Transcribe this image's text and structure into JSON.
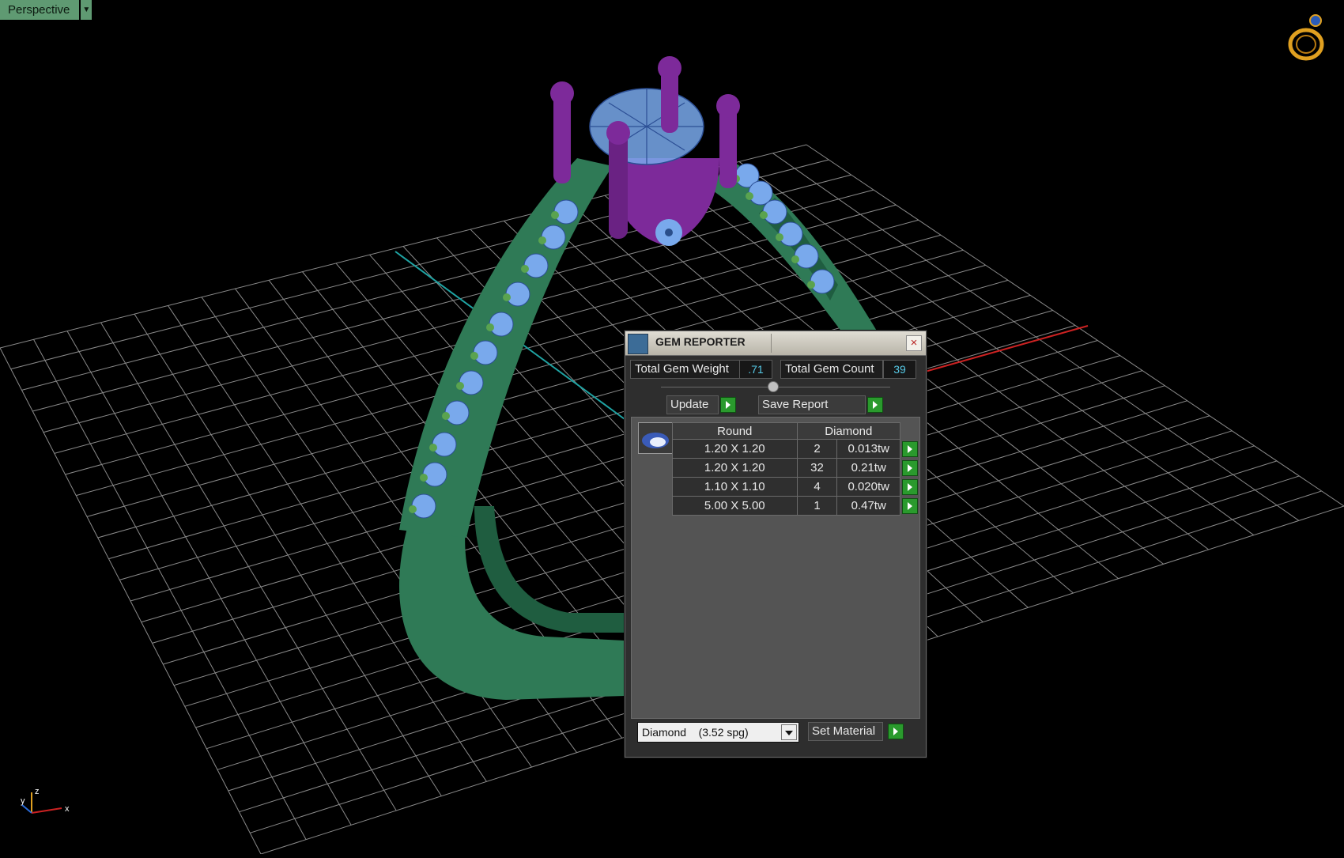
{
  "viewport": {
    "view_name": "Perspective",
    "background": "#000000",
    "grid_color": "#8a8a8a"
  },
  "icons": {
    "view_dropdown": "chevron-down-icon",
    "top_right": "ring-icon",
    "axis": "axis-gizmo-icon"
  },
  "axis_labels": {
    "x": "x",
    "y": "y",
    "z": "z"
  },
  "colors": {
    "band": "#2f7a56",
    "setting": "#7d2a9a",
    "gem_wire": "#79a9ec",
    "accent_green": "#2a9a2d",
    "value_blue": "#56c9e6",
    "axis_x": "#cc2222",
    "axis_y": "#1fa3a3"
  },
  "gem_reporter": {
    "title": "GEM REPORTER",
    "total_weight_label": "Total Gem Weight",
    "total_weight_value": ".71",
    "total_count_label": "Total Gem Count",
    "total_count_value": "39",
    "update_label": "Update",
    "save_report_label": "Save Report",
    "table": {
      "shape_header": "Round",
      "material_header": "Diamond",
      "rows": [
        {
          "size": "1.20 X 1.20",
          "count": "2",
          "weight": "0.013tw"
        },
        {
          "size": "1.20 X 1.20",
          "count": "32",
          "weight": "0.21tw"
        },
        {
          "size": "1.10 X 1.10",
          "count": "4",
          "weight": "0.020tw"
        },
        {
          "size": "5.00 X 5.00",
          "count": "1",
          "weight": "0.47tw"
        }
      ]
    },
    "material_select": "Diamond    (3.52 spg)",
    "set_material_label": "Set Material"
  }
}
